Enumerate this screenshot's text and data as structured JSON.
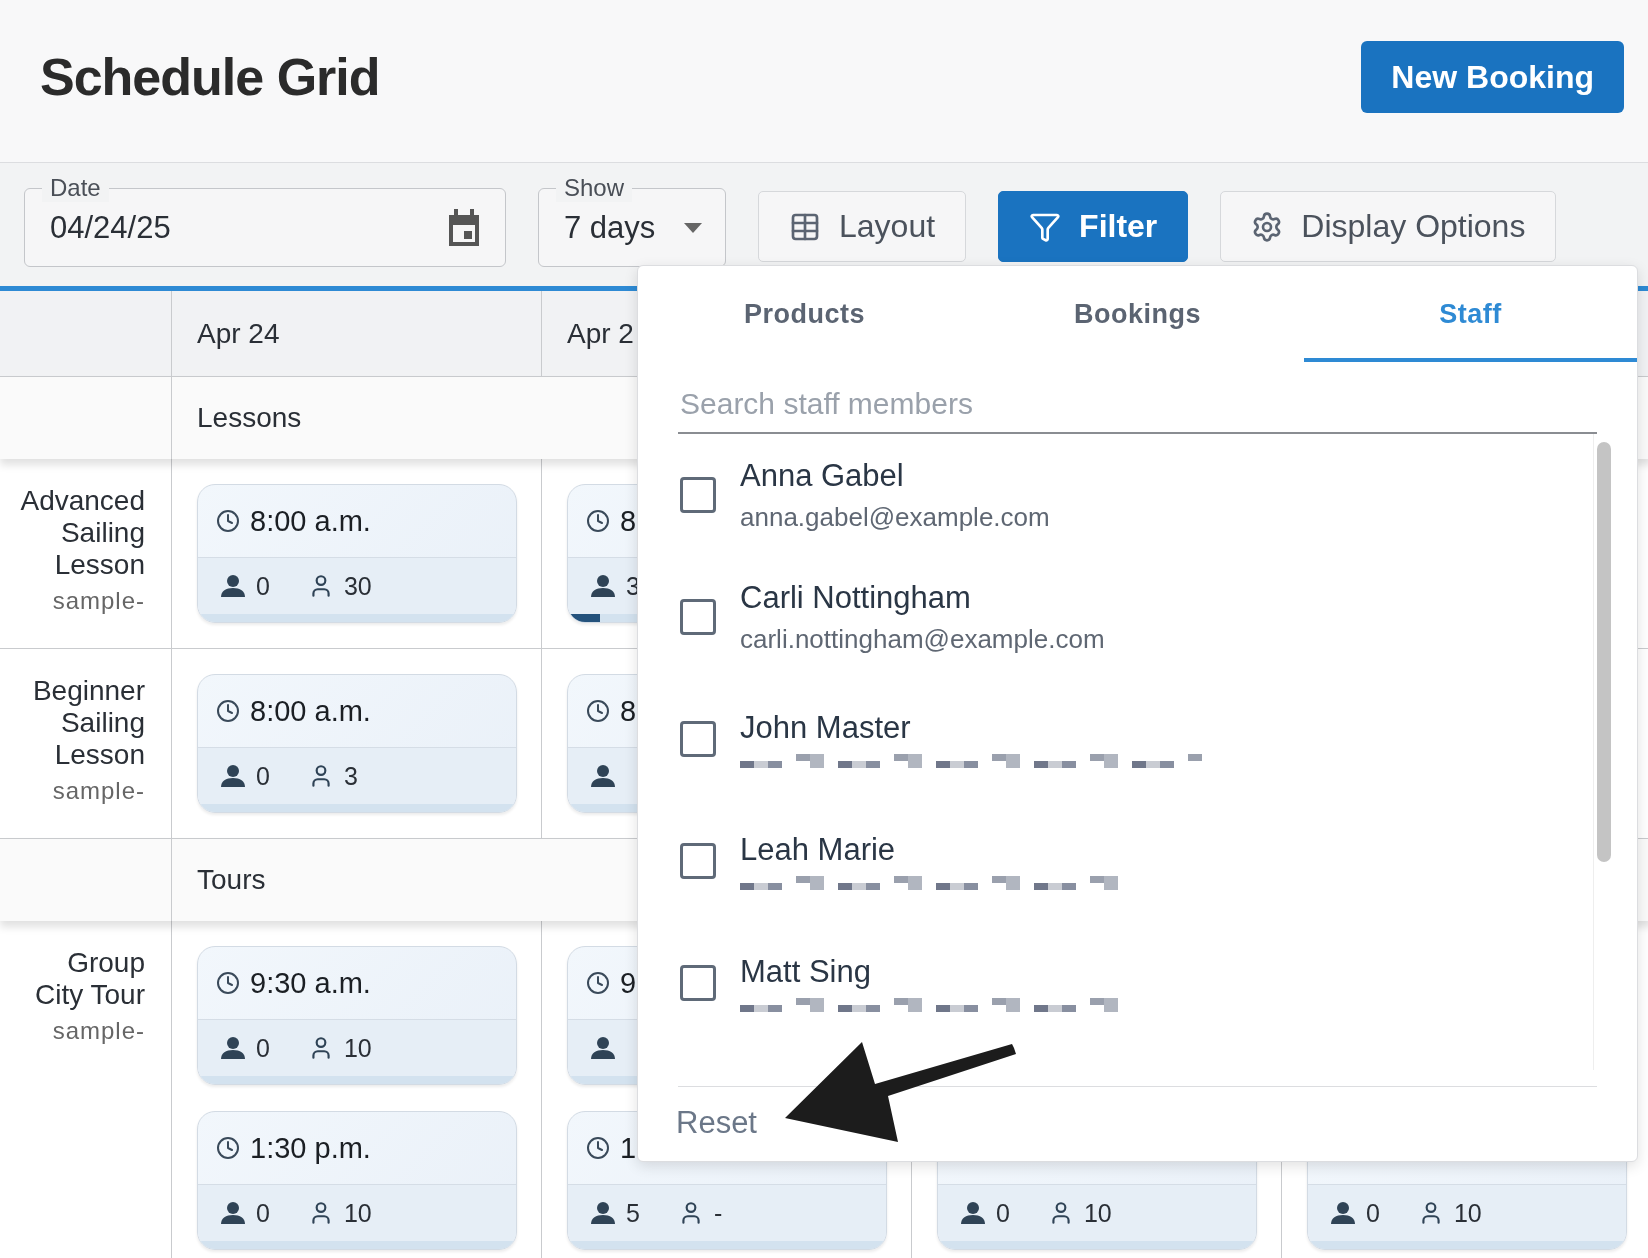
{
  "header": {
    "title": "Schedule Grid",
    "new_booking": "New Booking"
  },
  "date_field": {
    "label": "Date",
    "value": "04/24/25"
  },
  "show_field": {
    "label": "Show",
    "value": "7 days"
  },
  "toolbar_buttons": [
    {
      "label": "Layout",
      "kind": "layout",
      "selected": false
    },
    {
      "label": "Filter",
      "kind": "filter",
      "selected": true
    },
    {
      "label": "Display Options",
      "kind": "options",
      "selected": false
    }
  ],
  "grid": {
    "columns": [
      "Apr 24",
      "Apr 2"
    ],
    "groups": [
      {
        "label": "Lessons",
        "rows": [
          {
            "name": "Advanced Sailing Lesson",
            "sub": "sample-",
            "cells": [
              [
                {
                  "time": "8:00 a.m.",
                  "booked": "0",
                  "capacity": "30"
                }
              ],
              [
                {
                  "time": "8",
                  "booked": "3",
                  "level": 0.1
                }
              ],
              [],
              []
            ]
          },
          {
            "name": "Beginner Sailing Lesson",
            "sub": "sample-",
            "cells": [
              [
                {
                  "time": "8:00 a.m.",
                  "booked": "0",
                  "capacity": "3"
                }
              ],
              [
                {
                  "time": "8"
                }
              ],
              [],
              []
            ]
          }
        ]
      },
      {
        "label": "Tours",
        "rows": [
          {
            "name": "Group City Tour",
            "sub": "sample-",
            "cells": [
              [
                {
                  "time": "9:30 a.m.",
                  "booked": "0",
                  "capacity": "10"
                },
                {
                  "time": "1:30 p.m.",
                  "booked": "0",
                  "capacity": "10"
                }
              ],
              [
                {
                  "time": "9"
                },
                {
                  "time": "1",
                  "booked": "5",
                  "capacity": "-"
                }
              ],
              [
                {},
                {
                  "booked": "0",
                  "capacity": "10"
                }
              ],
              [
                {},
                {
                  "booked": "0",
                  "capacity": "10"
                }
              ]
            ]
          }
        ]
      }
    ]
  },
  "filter_panel": {
    "tabs": [
      {
        "label": "Products",
        "selected": false
      },
      {
        "label": "Bookings",
        "selected": false
      },
      {
        "label": "Staff",
        "selected": true
      }
    ],
    "search": {
      "placeholder": "Search staff members"
    },
    "staff": [
      {
        "name": "Anna Gabel",
        "email": "anna.gabel@example.com",
        "checked": false
      },
      {
        "name": "Carli Nottingham",
        "email": "carli.nottingham@example.com",
        "checked": false
      },
      {
        "name": "John Master",
        "checked": false
      },
      {
        "name": "Leah Marie",
        "checked": false
      },
      {
        "name": "Matt Sing",
        "checked": false
      }
    ],
    "reset": "Reset"
  }
}
